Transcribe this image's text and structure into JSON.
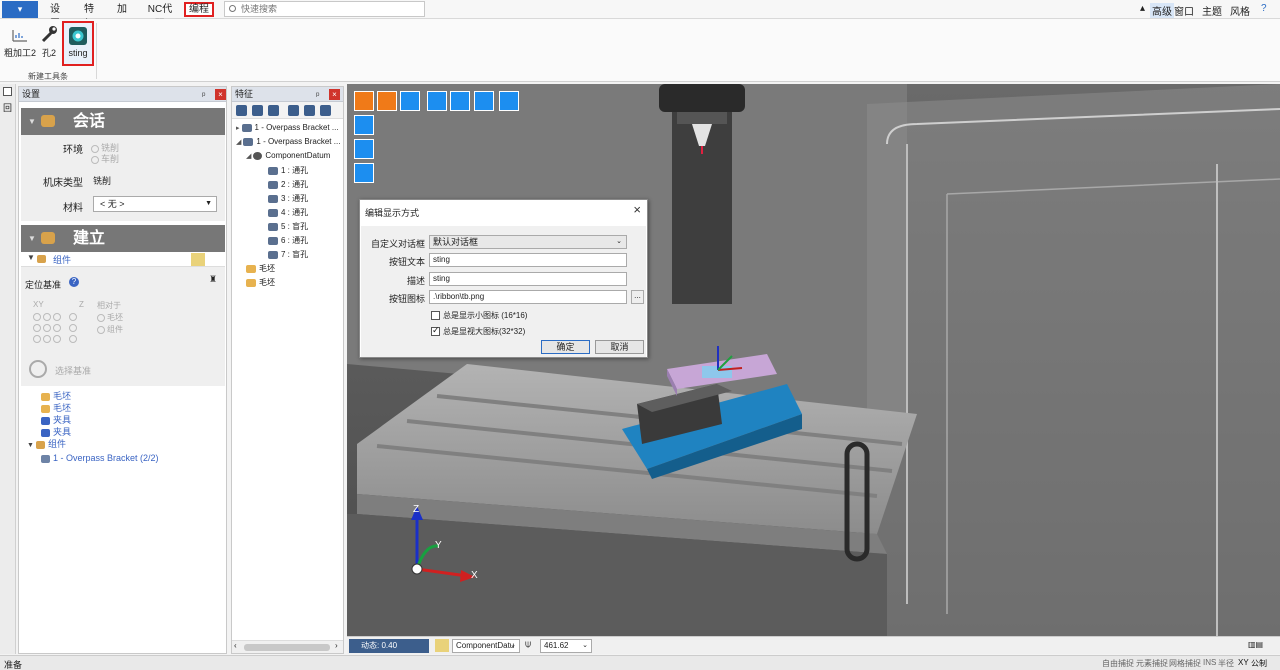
{
  "menubar": {
    "app_button": "文件",
    "tabs": [
      "设置",
      "特征",
      "加工",
      "NC代码",
      "编程"
    ],
    "active_tab": "编程",
    "search_placeholder": "快速搜索",
    "right_items": [
      "高级",
      "窗口",
      "主题",
      "风格"
    ]
  },
  "ribbon": {
    "buttons": [
      "粗加工2",
      "孔2",
      "sting"
    ],
    "group_label": "新建工具条"
  },
  "settings_panel": {
    "title": "设置",
    "session": {
      "title": "会话",
      "env_label": "环境",
      "env_options": [
        "铣削",
        "车削"
      ],
      "machine_label": "机床类型",
      "machine_value": "铣削",
      "material_label": "材料",
      "material_value": "< 无 >"
    },
    "build": {
      "title": "建立",
      "component_label": "组件",
      "datum_label": "定位基准",
      "xy_label": "XY",
      "z_label": "Z",
      "relative_label": "相对于",
      "relative_options": [
        "毛坯",
        "组件"
      ],
      "select_datum": "选择基准",
      "tree": [
        "毛坯",
        "毛坯",
        "夹具",
        "夹具",
        "组件",
        "1 - Overpass Bracket (2/2)"
      ]
    }
  },
  "feature_panel": {
    "title": "特征",
    "items": [
      "1 - Overpass Bracket ...",
      "1 - Overpass Bracket ...",
      "ComponentDatum",
      "1 : 通孔",
      "2 : 通孔",
      "3 : 通孔",
      "4 : 通孔",
      "5 : 盲孔",
      "6 : 通孔",
      "7 : 盲孔",
      "毛坯",
      "毛坯"
    ]
  },
  "dialog": {
    "title": "编辑显示方式",
    "custom_dialog_label": "自定义对话框",
    "custom_dialog_value": "默认对话框",
    "button_text_label": "按钮文本",
    "button_text_value": "sting",
    "desc_label": "描述",
    "desc_value": "sting",
    "icon_label": "按钮图标",
    "icon_value": ".\\ribbon\\tb.png",
    "browse_label": "...",
    "small_icon_label": "总是显示小图标 (16*16)",
    "large_icon_label": "总是显视大图标(32*32)",
    "ok_label": "确定",
    "cancel_label": "取消"
  },
  "viewport": {
    "axis_labels": [
      "Z",
      "Y",
      "X"
    ],
    "anim_label": "动态: 0.40",
    "datum_combo": "ComponentDatu",
    "value_combo": "461.62"
  },
  "statusbar": {
    "left": "准备",
    "items": [
      "自由捕捉",
      "元素捕捉",
      "网格捕捉",
      "INS",
      "半径",
      "XY",
      "公制"
    ]
  }
}
